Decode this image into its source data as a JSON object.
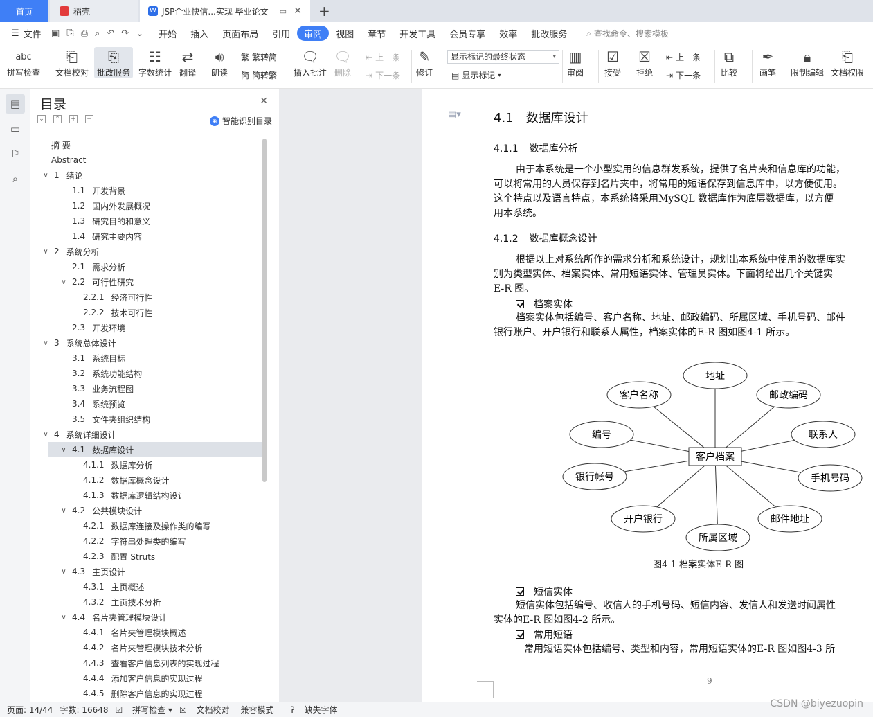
{
  "tabs": [
    {
      "label": "首页"
    },
    {
      "label": "稻壳"
    },
    {
      "label": "JSP企业快信...实现 毕业论文"
    }
  ],
  "menubar": {
    "file": "文件",
    "items": [
      "开始",
      "插入",
      "页面布局",
      "引用",
      "审阅",
      "视图",
      "章节",
      "开发工具",
      "会员专享",
      "效率",
      "批改服务"
    ],
    "active": "审阅",
    "search": "查找命令、搜索模板"
  },
  "ribbon": {
    "spell": "拼写检查",
    "proof": "文档校对",
    "grade": "批改服务",
    "wordcount": "字数统计",
    "translate": "翻译",
    "read": "朗读",
    "to_trad": "繁转简",
    "to_simp": "简转繁",
    "insert_comment": "插入批注",
    "delete": "删除",
    "prev": "上一条",
    "next": "下一条",
    "revise": "修订",
    "markup_state": "显示标记的最终状态",
    "show_markup": "显示标记",
    "review": "审阅",
    "accept": "接受",
    "reject": "拒绝",
    "prev2": "上一条",
    "next2": "下一条",
    "compare": "比较",
    "pen": "画笔",
    "restrict": "限制编辑",
    "doc_rights": "文档权限"
  },
  "toc": {
    "title": "目录",
    "smart": "智能识别目录",
    "items": [
      {
        "num": "",
        "text": "摘 要",
        "level": 0,
        "caret": ""
      },
      {
        "num": "",
        "text": "Abstract",
        "level": 0,
        "caret": ""
      },
      {
        "num": "1",
        "text": "绪论",
        "level": 0,
        "caret": "v"
      },
      {
        "num": "1.1",
        "text": "开发背景",
        "level": 1,
        "caret": ""
      },
      {
        "num": "1.2",
        "text": "国内外发展概况",
        "level": 1,
        "caret": ""
      },
      {
        "num": "1.3",
        "text": "研究目的和意义",
        "level": 1,
        "caret": ""
      },
      {
        "num": "1.4",
        "text": "研究主要内容",
        "level": 1,
        "caret": ""
      },
      {
        "num": "2",
        "text": "系统分析",
        "level": 0,
        "caret": "v"
      },
      {
        "num": "2.1",
        "text": "需求分析",
        "level": 1,
        "caret": ""
      },
      {
        "num": "2.2",
        "text": "可行性研究",
        "level": 1,
        "caret": "v"
      },
      {
        "num": "2.2.1",
        "text": "经济可行性",
        "level": 2,
        "caret": ""
      },
      {
        "num": "2.2.2",
        "text": "技术可行性",
        "level": 2,
        "caret": ""
      },
      {
        "num": "2.3",
        "text": "开发环境",
        "level": 1,
        "caret": ""
      },
      {
        "num": "3",
        "text": "系统总体设计",
        "level": 0,
        "caret": "v"
      },
      {
        "num": "3.1",
        "text": "系统目标",
        "level": 1,
        "caret": ""
      },
      {
        "num": "3.2",
        "text": "系统功能结构",
        "level": 1,
        "caret": ""
      },
      {
        "num": "3.3",
        "text": "业务流程图",
        "level": 1,
        "caret": ""
      },
      {
        "num": "3.4",
        "text": "系统预览",
        "level": 1,
        "caret": ""
      },
      {
        "num": "3.5",
        "text": "文件夹组织结构",
        "level": 1,
        "caret": ""
      },
      {
        "num": "4",
        "text": "系统详细设计",
        "level": 0,
        "caret": "v"
      },
      {
        "num": "4.1",
        "text": "数据库设计",
        "level": 1,
        "caret": "v",
        "selected": true
      },
      {
        "num": "4.1.1",
        "text": "数据库分析",
        "level": 2,
        "caret": ""
      },
      {
        "num": "4.1.2",
        "text": "数据库概念设计",
        "level": 2,
        "caret": ""
      },
      {
        "num": "4.1.3",
        "text": "数据库逻辑结构设计",
        "level": 2,
        "caret": ""
      },
      {
        "num": "4.2",
        "text": "公共模块设计",
        "level": 1,
        "caret": "v"
      },
      {
        "num": "4.2.1",
        "text": "数据库连接及操作类的编写",
        "level": 2,
        "caret": ""
      },
      {
        "num": "4.2.2",
        "text": "字符串处理类的编写",
        "level": 2,
        "caret": ""
      },
      {
        "num": "4.2.3",
        "text": "配置 Struts",
        "level": 2,
        "caret": ""
      },
      {
        "num": "4.3",
        "text": "主页设计",
        "level": 1,
        "caret": "v"
      },
      {
        "num": "4.3.1",
        "text": "主页概述",
        "level": 2,
        "caret": ""
      },
      {
        "num": "4.3.2",
        "text": "主页技术分析",
        "level": 2,
        "caret": ""
      },
      {
        "num": "4.4",
        "text": "名片夹管理模块设计",
        "level": 1,
        "caret": "v"
      },
      {
        "num": "4.4.1",
        "text": "名片夹管理模块概述",
        "level": 2,
        "caret": ""
      },
      {
        "num": "4.4.2",
        "text": "名片夹管理模块技术分析",
        "level": 2,
        "caret": ""
      },
      {
        "num": "4.4.3",
        "text": "查看客户信息列表的实现过程",
        "level": 2,
        "caret": ""
      },
      {
        "num": "4.4.4",
        "text": "添加客户信息的实现过程",
        "level": 2,
        "caret": ""
      },
      {
        "num": "4.4.5",
        "text": "删除客户信息的实现过程",
        "level": 2,
        "caret": ""
      }
    ]
  },
  "doc": {
    "h2_num": "4.1",
    "h2_text": "数据库设计",
    "h3a_num": "4.1.1",
    "h3a_text": "数据库分析",
    "p1": [
      "由于本系统是一个小型实用的信息群发系统，提供了名片夹和信息库的功能，",
      "可以将常用的人员保存到名片夹中，将常用的短语保存到信息库中，以方便使用。",
      "这个特点以及语言特点，本系统将采用MySQL 数据库作为底层数据库，以方便",
      "用本系统。"
    ],
    "h3b_num": "4.1.2",
    "h3b_text": "数据库概念设计",
    "p2": [
      "根据以上对系统所作的需求分析和系统设计，规划出本系统中使用的数据库实",
      "别为类型实体、档案实体、常用短语实体、管理员实体。下面将给出几个关键实",
      "E-R 图。"
    ],
    "cb1": "档案实体",
    "p3": [
      "档案实体包括编号、客户名称、地址、邮政编码、所属区域、手机号码、邮件",
      "银行账户、开户银行和联系人属性，档案实体的E-R 图如图4-1 所示。"
    ],
    "er": {
      "center": "客户档案",
      "attrs": [
        "地址",
        "邮政编码",
        "联系人",
        "手机号码",
        "邮件地址",
        "所属区域",
        "开户银行",
        "银行帐号",
        "编号",
        "客户名称"
      ]
    },
    "caption": "图4-1 档案实体E-R 图",
    "cb2": "短信实体",
    "p4": [
      "短信实体包括编号、收信人的手机号码、短信内容、发信人和发送时间属性",
      "实体的E-R 图如图4-2 所示。"
    ],
    "cb3": "常用短语",
    "p5": "常用短语实体包括编号、类型和内容，常用短语实体的E-R 图如图4-3 所",
    "page_number": "9"
  },
  "status": {
    "page": "页面: 14/44",
    "words": "字数: 16648",
    "spell": "拼写检查",
    "proof": "文档校对",
    "compat": "兼容模式",
    "missing_font": "缺失字体",
    "watermark": "CSDN @biyezuopin"
  }
}
